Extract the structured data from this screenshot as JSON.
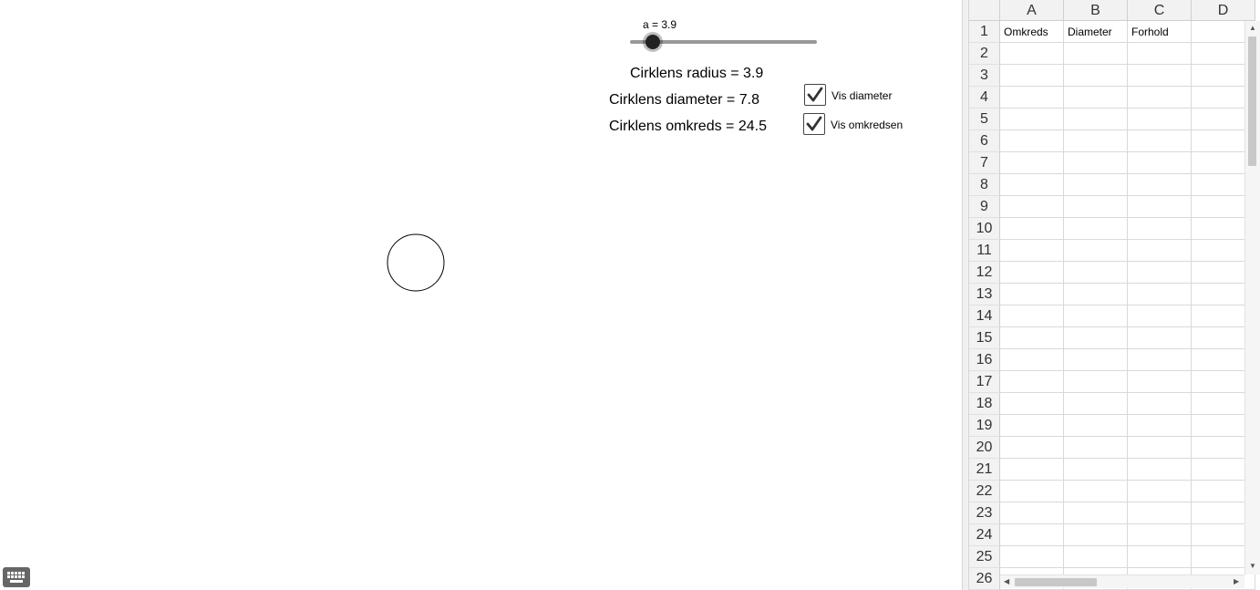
{
  "graphics": {
    "slider": {
      "label": "a = 3.9",
      "value": 3.9,
      "fraction": 0.12
    },
    "radius_text": "Cirklens radius = 3.9",
    "diameter_text": "Cirklens diameter = 7.8",
    "circumference_text": "Cirklens omkreds = 24.5",
    "checkboxes": [
      {
        "label": "Vis diameter",
        "checked": true
      },
      {
        "label": "Vis omkredsen",
        "checked": true
      }
    ],
    "keyboard_icon": "keyboard-icon"
  },
  "spreadsheet": {
    "columns": [
      "A",
      "B",
      "C",
      "D"
    ],
    "rows": [
      "1",
      "2",
      "3",
      "4",
      "5",
      "6",
      "7",
      "8",
      "9",
      "10",
      "11",
      "12",
      "13",
      "14",
      "15",
      "16",
      "17",
      "18",
      "19",
      "20",
      "21",
      "22",
      "23",
      "24",
      "25",
      "26"
    ],
    "cells": {
      "A1": "Omkreds",
      "B1": "Diameter",
      "C1": "Forhold"
    }
  }
}
